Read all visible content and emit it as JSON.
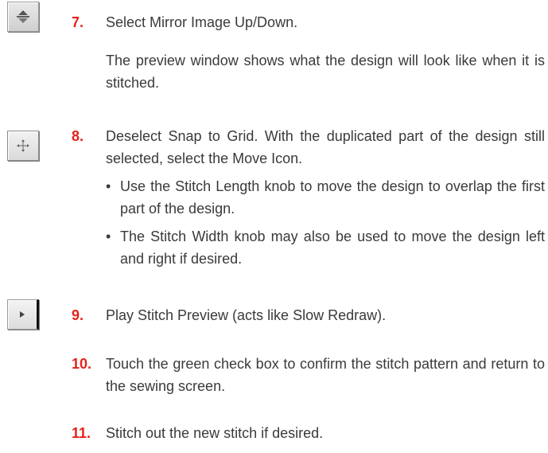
{
  "steps": [
    {
      "number": "7.",
      "text": "Select Mirror Image Up/Down.",
      "paragraph": "The preview window shows what the design will look like when it is stitched.",
      "icon": "mirror-up-down-icon"
    },
    {
      "number": "8.",
      "text": "Deselect Snap to Grid. With the duplicated part of the design still selected, select the Move Icon.",
      "bullets": [
        "Use the Stitch Length knob to move the design to overlap the first part of the design.",
        "The Stitch Width knob may also be used to move the design left and right if desired."
      ],
      "icon": "move-icon"
    },
    {
      "number": "9.",
      "text": "Play Stitch Preview (acts like Slow Redraw).",
      "icon": "play-icon"
    },
    {
      "number": "10.",
      "text": "Touch the green check box to confirm the stitch pattern and return to the sewing screen."
    },
    {
      "number": "11.",
      "text": "Stitch out the new stitch if desired."
    }
  ],
  "colors": {
    "step_number": "#e2231a",
    "body_text": "#3a3a3a"
  }
}
